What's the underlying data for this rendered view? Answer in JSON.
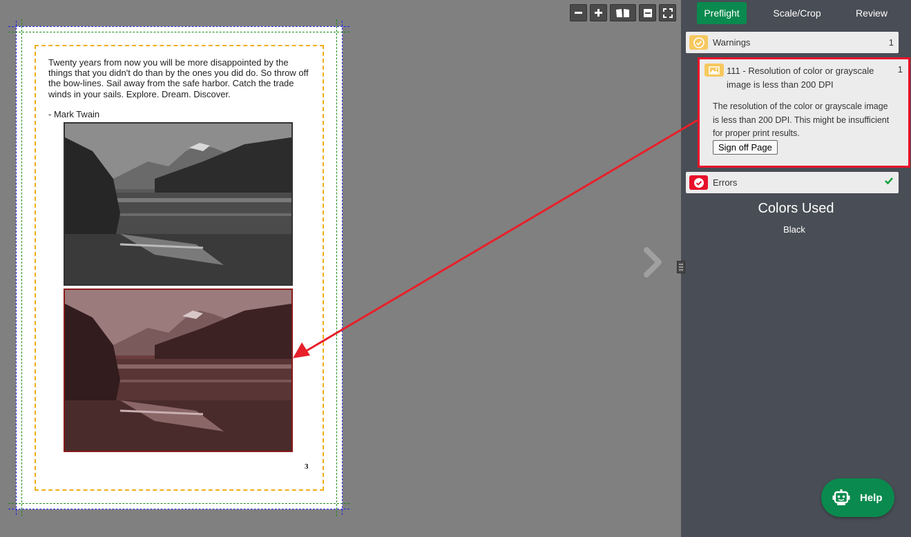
{
  "toolbar": {
    "buttons": [
      "zoom-out",
      "zoom-in",
      "two-page-view",
      "single-page-view",
      "fullscreen"
    ]
  },
  "page": {
    "quote": "Twenty years from now you will be more disappointed by the things that you didn't do than by the ones you did do. So throw off the bow-lines. Sail away from the safe harbor. Catch the trade winds in your sails. Explore. Dream. Discover.",
    "author": "- Mark Twain",
    "page_number": "3"
  },
  "tabs": [
    {
      "label": "Preflight",
      "active": true
    },
    {
      "label": "Scale/Crop",
      "active": false
    },
    {
      "label": "Review",
      "active": false
    }
  ],
  "warnings": {
    "label": "Warnings",
    "count": "1",
    "item": {
      "title": "111 - Resolution of color or grayscale image is less than 200 DPI",
      "count": "1",
      "description": "The resolution of the color or grayscale image is less than 200 DPI. This might be insufficient for proper print results.",
      "button": "Sign off Page"
    }
  },
  "errors": {
    "label": "Errors",
    "status": "ok"
  },
  "colors": {
    "title": "Colors Used",
    "items": [
      "Black"
    ]
  },
  "help": {
    "label": "Help"
  },
  "theme": {
    "accent": "#0a8a4e",
    "warning": "#f6c85f",
    "error": "#e8102a",
    "panel_bg": "#494d55"
  }
}
